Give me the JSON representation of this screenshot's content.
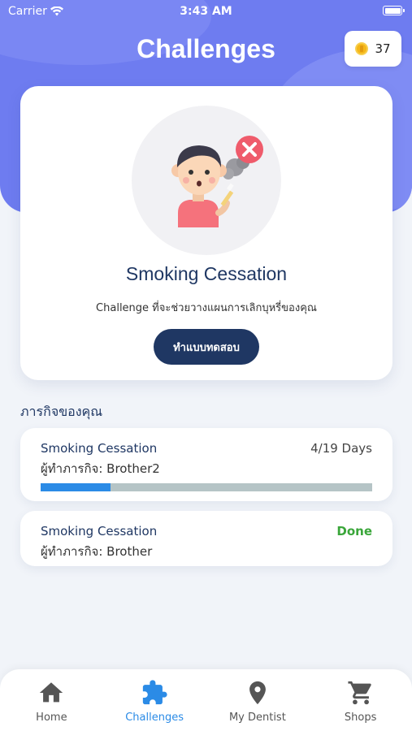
{
  "status_bar": {
    "carrier": "Carrier",
    "time": "3:43 AM"
  },
  "header": {
    "title": "Challenges",
    "coins": "37"
  },
  "featured": {
    "title": "Smoking Cessation",
    "description": "Challenge ที่จะช่วยวางแผนการเลิกบุหรี่ของคุณ",
    "button_label": "ทำแบบทดสอบ"
  },
  "missions": {
    "section_title": "ภารกิจของคุณ",
    "items": [
      {
        "name": "Smoking Cessation",
        "owner": "ผู้ทำภารกิจ: Brother2",
        "status": "4/19 Days",
        "progress": 0.21
      },
      {
        "name": "Smoking Cessation",
        "owner": "ผู้ทำภารกิจ: Brother",
        "status": "Done"
      }
    ]
  },
  "nav": {
    "items": [
      {
        "label": "Home",
        "icon": "home-icon"
      },
      {
        "label": "Challenges",
        "icon": "puzzle-icon",
        "active": true
      },
      {
        "label": "My Dentist",
        "icon": "map-pin-icon"
      },
      {
        "label": "Shops",
        "icon": "cart-icon"
      }
    ]
  },
  "colors": {
    "header": "#6e7cf0",
    "navy": "#1f3763",
    "accent": "#2b8be6",
    "done": "#3aa63a"
  }
}
